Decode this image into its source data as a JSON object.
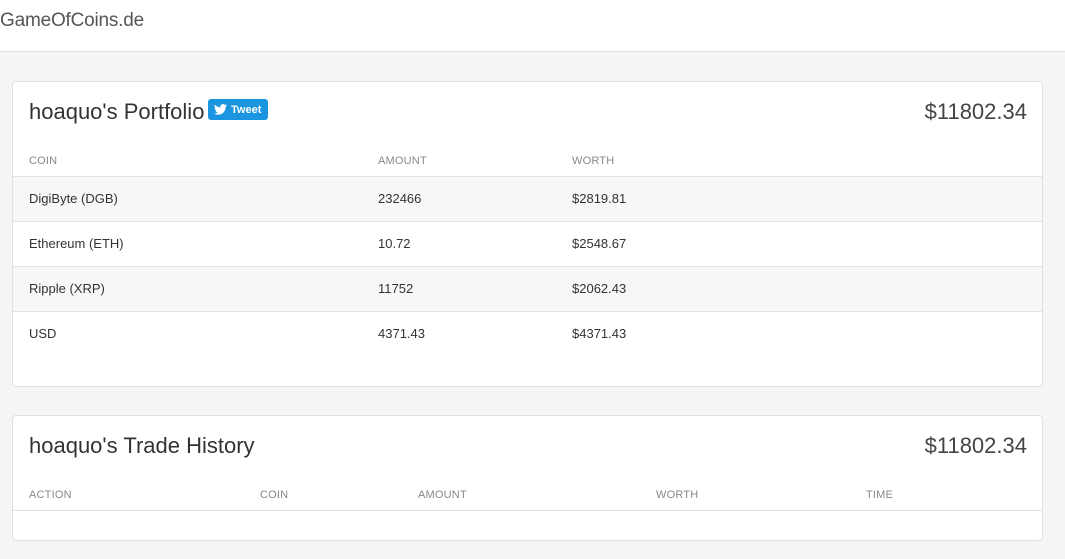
{
  "header": {
    "brand": "GameOfCoins.de"
  },
  "portfolio": {
    "title": "hoaquo's Portfolio",
    "tweet_label": "Tweet",
    "total": "$11802.34",
    "columns": [
      "COIN",
      "AMOUNT",
      "WORTH"
    ],
    "rows": [
      {
        "coin": "DigiByte (DGB)",
        "amount": "232466",
        "worth": "$2819.81"
      },
      {
        "coin": "Ethereum (ETH)",
        "amount": "10.72",
        "worth": "$2548.67"
      },
      {
        "coin": "Ripple (XRP)",
        "amount": "11752",
        "worth": "$2062.43"
      },
      {
        "coin": "USD",
        "amount": "4371.43",
        "worth": "$4371.43"
      }
    ]
  },
  "history": {
    "title": "hoaquo's Trade History",
    "total": "$11802.34",
    "columns": [
      "ACTION",
      "COIN",
      "AMOUNT",
      "WORTH",
      "TIME"
    ]
  },
  "colors": {
    "tweet_button": "#1b95e0",
    "row_shade": "#f7f7f7",
    "page_background": "#f5f5f5"
  },
  "icons": {
    "tweet": "twitter-bird-icon"
  }
}
